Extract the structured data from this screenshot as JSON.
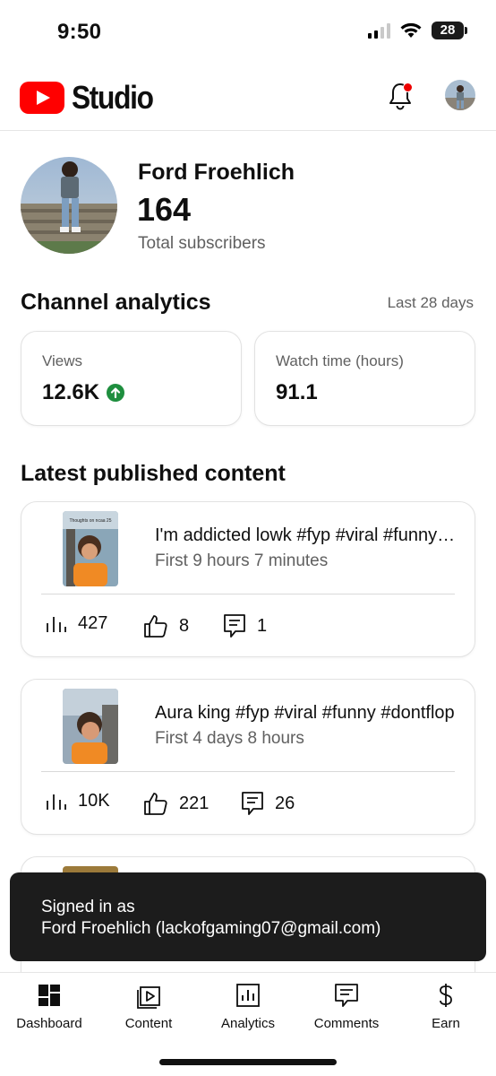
{
  "status_bar": {
    "time": "9:50",
    "battery": "28"
  },
  "app": {
    "logo_text": "Studio"
  },
  "channel": {
    "name": "Ford Froehlich",
    "subscribers": "164",
    "subscribers_label": "Total subscribers"
  },
  "analytics": {
    "title": "Channel analytics",
    "period": "Last 28 days",
    "cards": [
      {
        "label": "Views",
        "value": "12.6K",
        "trend": "up",
        "trend_color": "#1e8e3e"
      },
      {
        "label": "Watch time (hours)",
        "value": "91.1"
      }
    ]
  },
  "latest": {
    "title": "Latest published content",
    "items": [
      {
        "title": "I'm addicted lowk #fyp #viral #funny #dontflop",
        "subtitle": "First 9 hours 7 minutes",
        "thumb_caption": "Thoughts on ncaa 25",
        "views": "427",
        "likes": "8",
        "comments": "1"
      },
      {
        "title": "Aura king #fyp #viral #funny #dontflop",
        "subtitle": "First 4 days 8 hours",
        "views": "10K",
        "likes": "221",
        "comments": "26"
      }
    ]
  },
  "toast": {
    "line1": "Signed in as",
    "line2": "Ford Froehlich (lackofgaming07@gmail.com)"
  },
  "nav": [
    {
      "label": "Dashboard",
      "icon": "dashboard-icon",
      "active": true
    },
    {
      "label": "Content",
      "icon": "content-icon"
    },
    {
      "label": "Analytics",
      "icon": "analytics-icon"
    },
    {
      "label": "Comments",
      "icon": "comments-icon"
    },
    {
      "label": "Earn",
      "icon": "dollar-icon"
    }
  ],
  "colors": {
    "brand": "#ff0000",
    "text_secondary": "#606060",
    "notification_dot": "#e00000"
  }
}
